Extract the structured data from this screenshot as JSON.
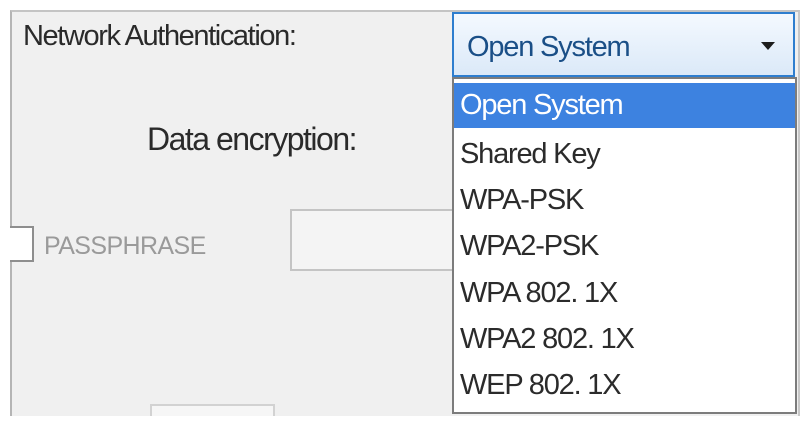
{
  "auth": {
    "label": "Network Authentication:",
    "selected": "Open System",
    "options": [
      "Open System",
      "Shared Key",
      "WPA-PSK",
      "WPA2-PSK",
      "WPA 802. 1X",
      "WPA2 802. 1X",
      "WEP 802. 1X"
    ],
    "highlight_color": "#3d82e0"
  },
  "encryption": {
    "label": "Data encryption:"
  },
  "passphrase": {
    "label": "PASSPHRASE",
    "value": ""
  }
}
